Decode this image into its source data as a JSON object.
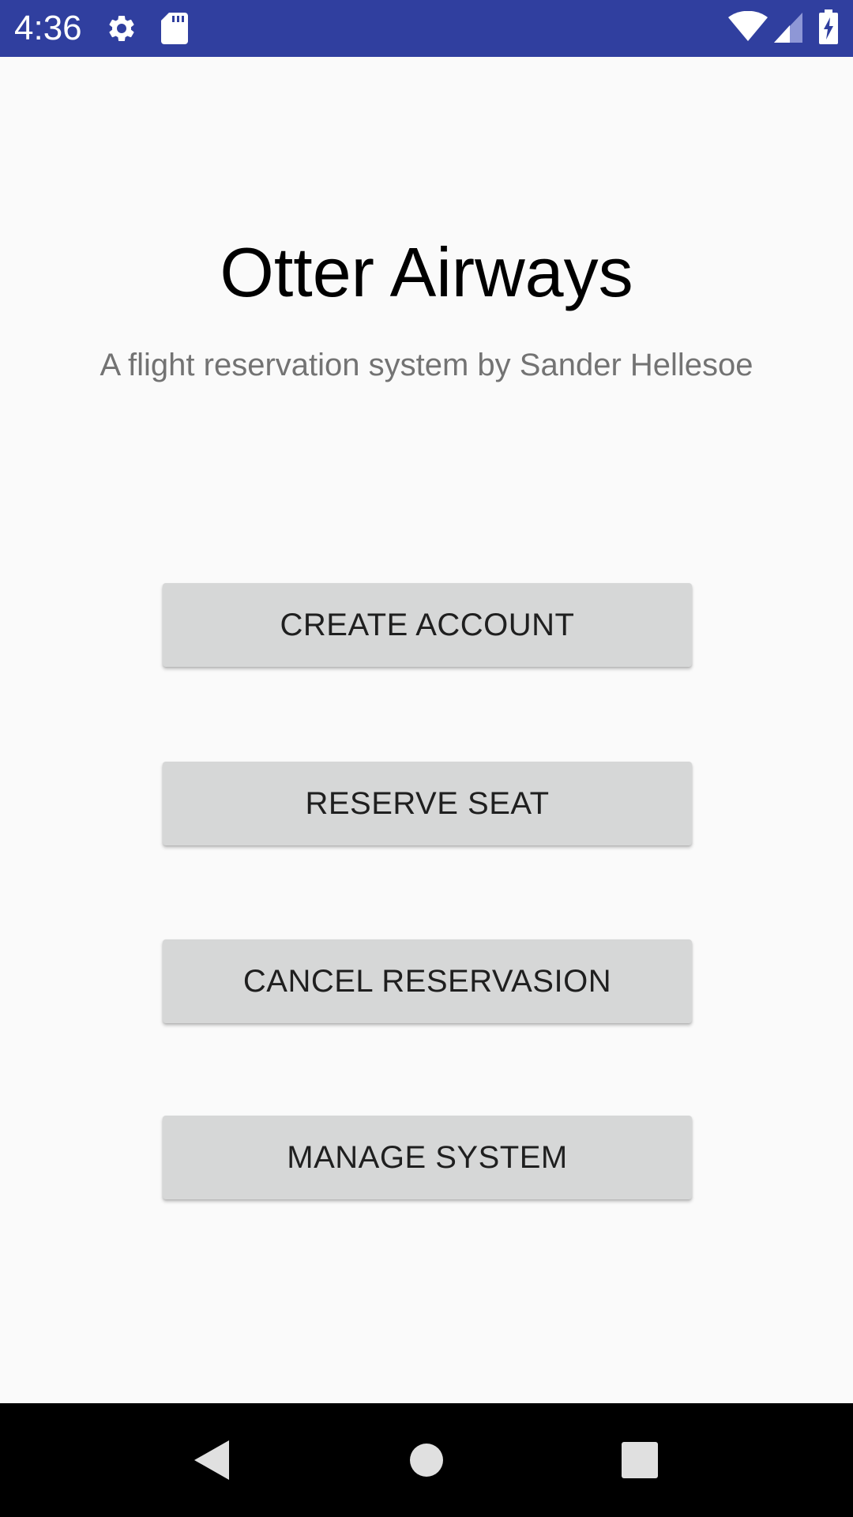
{
  "status_bar": {
    "time": "4:36",
    "background": "#303f9f",
    "icons": [
      "settings-icon",
      "sd-card-icon",
      "wifi-icon",
      "signal-icon",
      "battery-charging-icon"
    ]
  },
  "main": {
    "title": "Otter Airways",
    "subtitle": "A flight reservation system by Sander Hellesoe"
  },
  "buttons": {
    "create_account": "CREATE ACCOUNT",
    "reserve_seat": "RESERVE SEAT",
    "cancel_reservation": "CANCEL RESERVASION",
    "manage_system": "MANAGE SYSTEM"
  },
  "nav_bar": {
    "icons": [
      "back-icon",
      "home-icon",
      "recents-icon"
    ]
  }
}
